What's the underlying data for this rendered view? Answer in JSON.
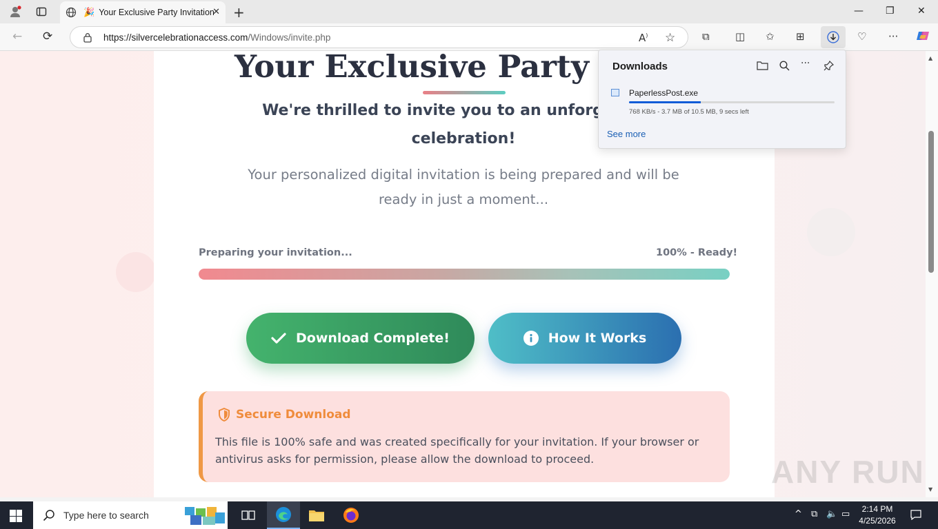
{
  "browser": {
    "tab_title": "Your Exclusive Party Invitation",
    "url_host": "https://silvercelebrationaccess.com",
    "url_path": "/Windows/invite.php"
  },
  "page": {
    "heading": "Your Exclusive Party Invi",
    "subtitle": "We're thrilled to invite you to an unforgettable celebration!",
    "lead": "Your personalized digital invitation is being prepared and will be ready in just a moment...",
    "progress_label": "Preparing your invitation...",
    "progress_status": "100% - Ready!",
    "progress_value": 1.0,
    "download_button": "Download Complete!",
    "how_button": "How It Works",
    "notice_title": "Secure Download",
    "notice_text": "This file is 100% safe and was created specifically for your invitation. If your browser or antivirus asks for permission, please allow the download to proceed."
  },
  "downloads": {
    "title": "Downloads",
    "file_name": "PaperlessPost.exe",
    "status": "768 KB/s - 3.7 MB of 10.5 MB, 9 secs left",
    "progress_fraction": 0.35,
    "see_more": "See more"
  },
  "taskbar": {
    "search_placeholder": "Type here to search",
    "time": "2:14 PM",
    "date": "4/25/2026"
  },
  "watermark": "ANY RUN",
  "colors": {
    "download_button": "#3aa765",
    "how_button": "#3a97bf",
    "notice_accent": "#ef8c3c",
    "notice_bg": "#fde0df",
    "edge_download_bar": "#0f5bd7"
  }
}
